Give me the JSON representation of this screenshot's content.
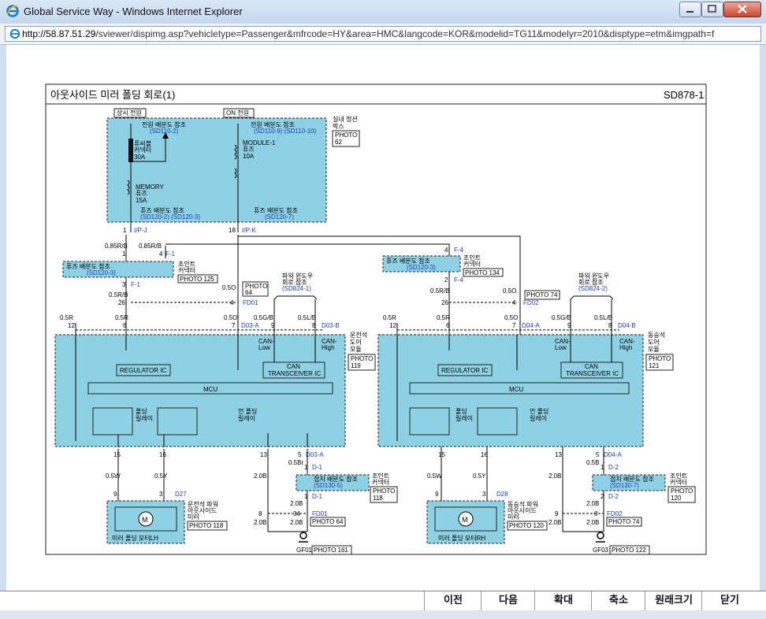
{
  "window": {
    "title": "Global Service Way - Windows Internet Explorer",
    "url_host": "http://58.87.51.29",
    "url_rest": "/sviewer/dispimg.asp?vehicletype=Passenger&mfrcode=HY&area=HMC&langcode=KOR&modelid=TG11&modelyr=2010&disptype=etm&imgpath=f"
  },
  "diagram": {
    "title": "아웃사이드 미러 폴딩 회로(1)",
    "code": "SD878-1",
    "box_const": "상시 전원",
    "box_on": "ON 전원",
    "junction_box": [
      "실내 정션",
      "박스"
    ],
    "photo62": [
      "PHOTO",
      "62"
    ],
    "left_top_ref": "전원 배분도 참조",
    "left_top_sd": "(SD110-2)",
    "right_top_ref": "전원 배분도 참조",
    "right_top_sd": "(SD110-9)  (SD110-10)",
    "fusible": [
      "퓨씨블",
      "커넥터",
      "30A"
    ],
    "memory": [
      "MEMORY",
      "퓨즈",
      "15A"
    ],
    "module1": [
      "MODULE-1",
      "퓨즈",
      "10A"
    ],
    "fuse_ref_l": "퓨즈 배분도 참조",
    "fuse_ref_l_sd": "(SD120-2)  (SD120-3)",
    "fuse_ref_r": "퓨즈 배분도 참조",
    "fuse_ref_r_sd": "(SD120-7)",
    "pin1": "1",
    "pin_ipj": "I/P-J",
    "pin18": "18",
    "pin_ipk": "I/P-K",
    "w085": "0.85R/B",
    "w05r": "0.5R",
    "w05rb": "0.5R/B",
    "w05o": "0.5O",
    "w05gb": "0.5G/B",
    "w05lb": "0.5L/B",
    "w05w": "0.5W",
    "w05y": "0.5Y",
    "w05b": "0.5B",
    "w20b": "2.0B",
    "w05br": "0.5Br",
    "f1": "F-1",
    "f4": "F-4",
    "fd01": "FD01",
    "fd02": "FD02",
    "joint_ref": "퓨즈 배분도 참조",
    "joint_sd_l": "(SD120-3)",
    "joint_sd_r": "(SD120-3)",
    "joint_conn": [
      "조인트",
      "커넥터"
    ],
    "photo125": "PHOTO 125",
    "photo134": "PHOTO 134",
    "photo64": [
      "PHOTO",
      "64"
    ],
    "photo74": "PHOTO 74",
    "pw_ref_l": [
      "파워 윈도우",
      "회로 참조",
      "(SD824-1)"
    ],
    "pw_ref_r": [
      "파워 윈도우",
      "회로 참조",
      "(SD824-2)"
    ],
    "d03a": "D03-A",
    "d03b": "D03-B",
    "d04a": "D04-A",
    "d04b": "D04-B",
    "drv_module_l": [
      "운전석",
      "도어",
      "모듈"
    ],
    "drv_module_r": [
      "동승석",
      "도어",
      "모듈"
    ],
    "photo119": [
      "PHOTO",
      "119"
    ],
    "photo121": [
      "PHOTO",
      "121"
    ],
    "can_low": [
      "CAN-",
      "Low"
    ],
    "can_high": [
      "CAN-",
      "High"
    ],
    "can_tx": [
      "CAN",
      "TRANSCEIVER IC"
    ],
    "regulator": "REGULATOR IC",
    "mcu": "MCU",
    "fold_relay": [
      "폴딩",
      "릴레이"
    ],
    "unfold_relay": [
      "언 폴딩",
      "릴레이"
    ],
    "d27": "D27",
    "d28": "D28",
    "mirror_l": [
      "운전석 파워",
      "아웃사이드",
      "미러"
    ],
    "mirror_r": [
      "동승석 파워",
      "아웃사이드",
      "미러"
    ],
    "photo118": "PHOTO 118",
    "photo120": "PHOTO 120",
    "motor_lh": "미러 폴딩 모터LH",
    "motor_rh": "미러 폴딩 모터RH",
    "gnd_ref": "접지 배분도 참조",
    "gnd_sd_l": "(SD130-5)",
    "gnd_sd_r": "(SD130-7)",
    "photo118b": [
      "PHOTO",
      "118"
    ],
    "photo120b": [
      "PHOTO",
      "120"
    ],
    "d1": "D-1",
    "d2": "D-2",
    "photo64b": "PHOTO 64",
    "photo74b": "PHOTO 74",
    "gf01": "GF01",
    "gf03": "GF03",
    "photo161": "PHOTO 161",
    "photo122": "PHOTO 122",
    "pins": {
      "p1": "1",
      "p4": "4",
      "p3": "3",
      "p2": "2",
      "p26": "26",
      "p12": "12",
      "p6": "6",
      "p7": "7",
      "p9": "9",
      "p8": "8",
      "p15": "15",
      "p16": "16",
      "p13": "13",
      "p5": "5",
      "p34": "34"
    }
  },
  "footer": {
    "prev": "이전",
    "next": "다음",
    "zoom_in": "확대",
    "zoom_out": "축소",
    "original": "원래크기",
    "close": "닫기"
  }
}
